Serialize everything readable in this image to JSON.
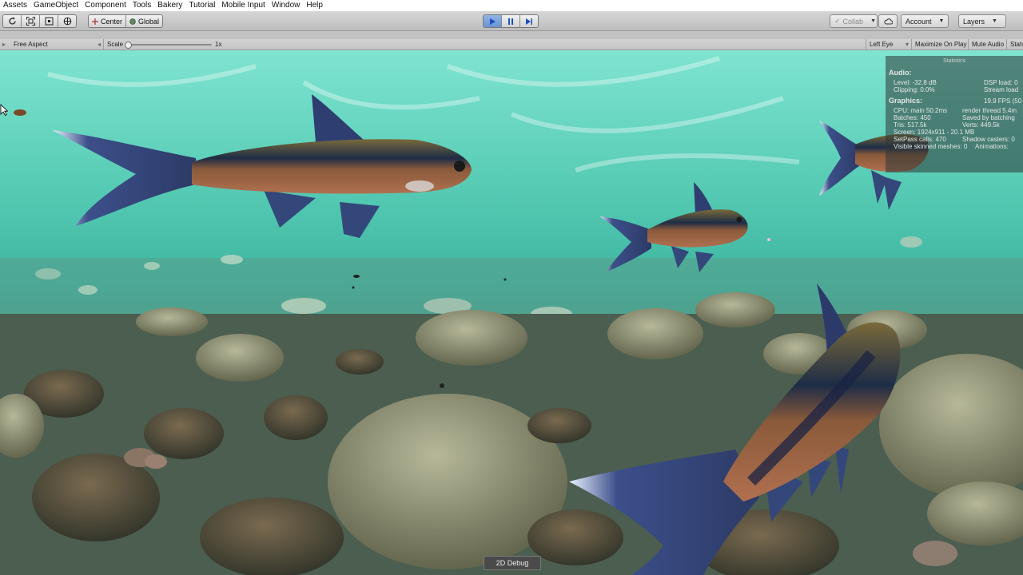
{
  "menu": [
    "Assets",
    "GameObject",
    "Component",
    "Tools",
    "Bakery",
    "Tutorial",
    "Mobile Input",
    "Window",
    "Help"
  ],
  "toolbar": {
    "tools": [
      "rotate-icon",
      "rect-icon",
      "scale-icon",
      "transform-icon"
    ],
    "pivot_center": "Center",
    "pivot_global": "Global",
    "collab": "Collab",
    "account": "Account",
    "layers": "Layers"
  },
  "game_view": {
    "aspect": "Free Aspect",
    "scale_label": "Scale",
    "scale_value": "1x",
    "left_eye": "Left Eye",
    "maximize": "Maximize On Play",
    "mute": "Mute Audio",
    "stats_tab": "Stats"
  },
  "stats": {
    "title": "Statistics",
    "audio_label": "Audio:",
    "audio": [
      [
        "Level: -32.8 dB",
        "DSP load: 0"
      ],
      [
        "Clipping: 0.0%",
        "Stream load"
      ]
    ],
    "graphics_label": "Graphics:",
    "fps": "19.9 FPS (50",
    "graphics": [
      [
        "CPU: main 50.2ms",
        "render thread 5.4m"
      ],
      [
        "Batches: 450",
        "Saved by batching"
      ],
      [
        "Tris: 517.5k",
        "Verts: 449.5k"
      ],
      [
        "Screen: 1924x911 - 20.1 MB",
        ""
      ],
      [
        "SetPass calls: 470",
        "Shadow casters: 0"
      ],
      [
        "Visible skinned meshes: 0",
        "Animations:"
      ]
    ]
  },
  "debug_button": "2D Debug",
  "colors": {
    "water_top": "#7fe4d1",
    "water_mid": "#3db5a0",
    "play_active": "#6a92cf"
  }
}
